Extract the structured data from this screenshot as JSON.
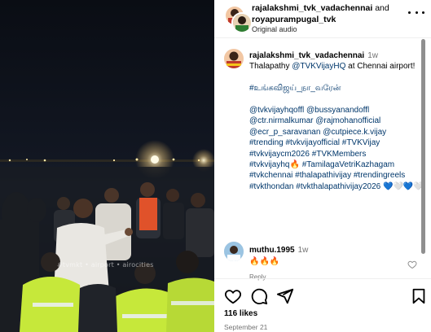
{
  "media": {
    "watermark": "#tvmkt • airport • airocities"
  },
  "header": {
    "user1": "rajalakshmi_tvk_vadachennai",
    "joiner": "and",
    "user2": "royapurampugal_tvk",
    "audio": "Original audio"
  },
  "caption": {
    "username": "rajalakshmi_tvk_vadachennai",
    "time": "1w",
    "line1_pre": "Thalapathy ",
    "line1_mention": "@TVKVijayHQ",
    "line1_post": " at Chennai airport!",
    "tamil_tag": "#உங்கவிஜய்_நா_வரேன்",
    "mentions": "@tvkvijayhqoffl @bussyanandoffl @ctr.nirmalkumar @rajmohanofficial @ecr_p_saravanan @cutpiece.k.vijay",
    "tags1": "#trending #tvkvijayofficial #TVKVijay #tvkvijaycm2026 #TVKMembers",
    "tags2_a": "#tvkvijayhq",
    "tags2_emoji": "🔥",
    "tags2_b": " #TamilagaVetriKazhagam #tvkchennai #thalapathivijay #trendingreels #tvkthondan #tvkthalapathivijay2026",
    "tail_hearts": "💙🤍💙🤍"
  },
  "comment": {
    "username": "muthu.1995",
    "time": "1w",
    "text": "🔥🔥🔥",
    "reply": "Reply"
  },
  "footer": {
    "likes": "116 likes",
    "date": "September 21"
  },
  "colors": {
    "link": "#00376b",
    "muted": "#737373",
    "vest": "#c6e83a"
  }
}
